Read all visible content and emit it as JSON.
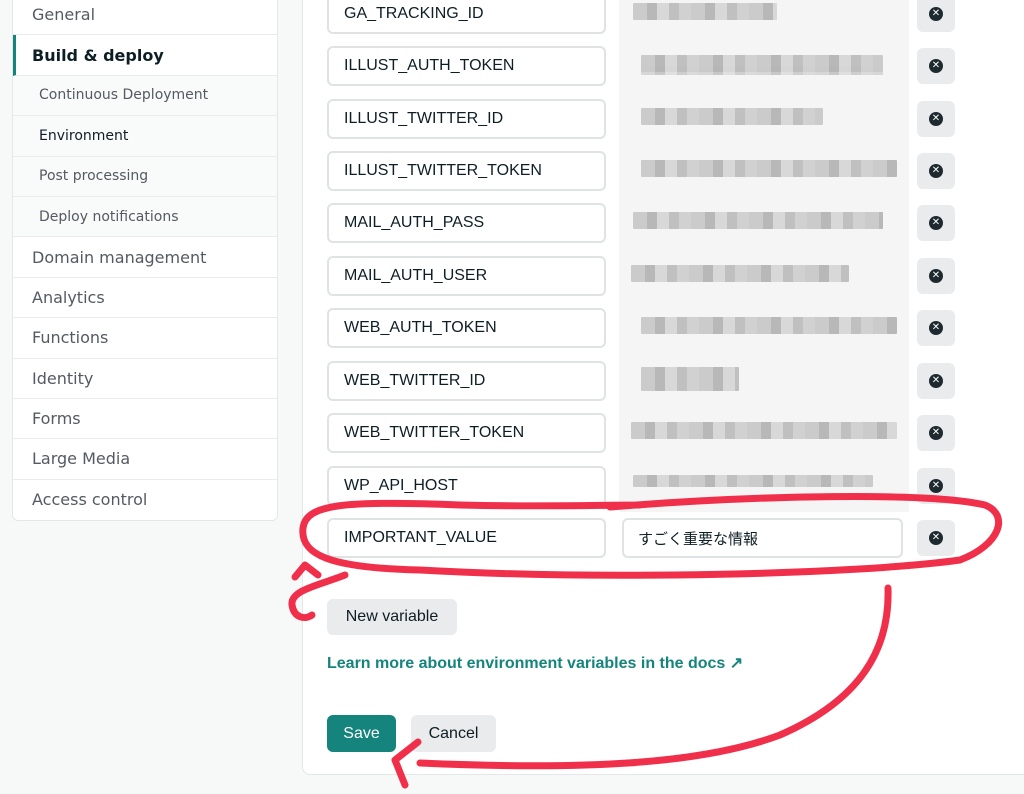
{
  "sidebar": {
    "items": [
      {
        "label": "General"
      },
      {
        "label": "Build & deploy"
      },
      {
        "label": "Domain management"
      },
      {
        "label": "Analytics"
      },
      {
        "label": "Functions"
      },
      {
        "label": "Identity"
      },
      {
        "label": "Forms"
      },
      {
        "label": "Large Media"
      },
      {
        "label": "Access control"
      }
    ],
    "subitems": [
      {
        "label": "Continuous Deployment"
      },
      {
        "label": "Environment"
      },
      {
        "label": "Post processing"
      },
      {
        "label": "Deploy notifications"
      }
    ]
  },
  "variables": [
    {
      "key": "GA_TRACKING_ID",
      "value_blurred": true
    },
    {
      "key": "ILLUST_AUTH_TOKEN",
      "value_blurred": true
    },
    {
      "key": "ILLUST_TWITTER_ID",
      "value_blurred": true
    },
    {
      "key": "ILLUST_TWITTER_TOKEN",
      "value_blurred": true
    },
    {
      "key": "MAIL_AUTH_PASS",
      "value_blurred": true
    },
    {
      "key": "MAIL_AUTH_USER",
      "value_blurred": true
    },
    {
      "key": "WEB_AUTH_TOKEN",
      "value_blurred": true
    },
    {
      "key": "WEB_TWITTER_ID",
      "value_blurred": true
    },
    {
      "key": "WEB_TWITTER_TOKEN",
      "value_blurred": true
    },
    {
      "key": "WP_API_HOST",
      "value_blurred": true
    },
    {
      "key": "IMPORTANT_VALUE",
      "value": "すごく重要な情報"
    }
  ],
  "actions": {
    "new_variable": "New variable",
    "docs_link": "Learn more about environment variables in the docs ↗",
    "save": "Save",
    "cancel": "Cancel"
  },
  "colors": {
    "accent": "#15847d",
    "annotation": "#f0304a"
  },
  "icons": {
    "delete": "close-circle-icon"
  }
}
